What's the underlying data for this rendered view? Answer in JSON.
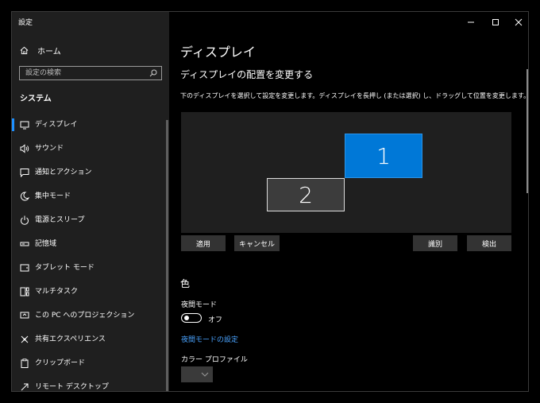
{
  "window": {
    "title": "設定",
    "controls": [
      "minimize-icon",
      "maximize-icon",
      "close-icon"
    ]
  },
  "sidebar": {
    "home_label": "ホーム",
    "search_placeholder": "設定の検索",
    "section_title": "システム",
    "items": [
      {
        "label": "ディスプレイ",
        "icon": "monitor-icon",
        "active": true
      },
      {
        "label": "サウンド",
        "icon": "speaker-icon"
      },
      {
        "label": "通知とアクション",
        "icon": "notification-icon"
      },
      {
        "label": "集中モード",
        "icon": "moon-icon"
      },
      {
        "label": "電源とスリープ",
        "icon": "power-icon"
      },
      {
        "label": "記憶域",
        "icon": "storage-icon"
      },
      {
        "label": "タブレット モード",
        "icon": "tablet-icon"
      },
      {
        "label": "マルチタスク",
        "icon": "multitask-icon"
      },
      {
        "label": "この PC へのプロジェクション",
        "icon": "projection-icon"
      },
      {
        "label": "共有エクスペリエンス",
        "icon": "shared-icon"
      },
      {
        "label": "クリップボード",
        "icon": "clipboard-icon"
      },
      {
        "label": "リモート デスクトップ",
        "icon": "remote-icon"
      }
    ]
  },
  "main": {
    "title": "ディスプレイ",
    "arrange_title": "ディスプレイの配置を変更する",
    "arrange_desc": "下のディスプレイを選択して設定を変更します。ディスプレイを長押し (または選択) し、ドラッグして位置を変更します。",
    "monitors": [
      {
        "number": "1",
        "selected": true
      },
      {
        "number": "2",
        "selected": false
      }
    ],
    "buttons": {
      "apply": "適用",
      "cancel": "キャンセル",
      "identify": "識別",
      "detect": "検出"
    },
    "color_heading": "色",
    "night_mode_label": "夜間モード",
    "night_mode_state": "オフ",
    "night_mode_link": "夜間モードの設定",
    "color_profile_label": "カラー プロファイル"
  },
  "colors": {
    "accent": "#0078d7",
    "link": "#4aa3ff",
    "sidebar_bg": "#1f1f1f",
    "main_bg": "#000000"
  }
}
